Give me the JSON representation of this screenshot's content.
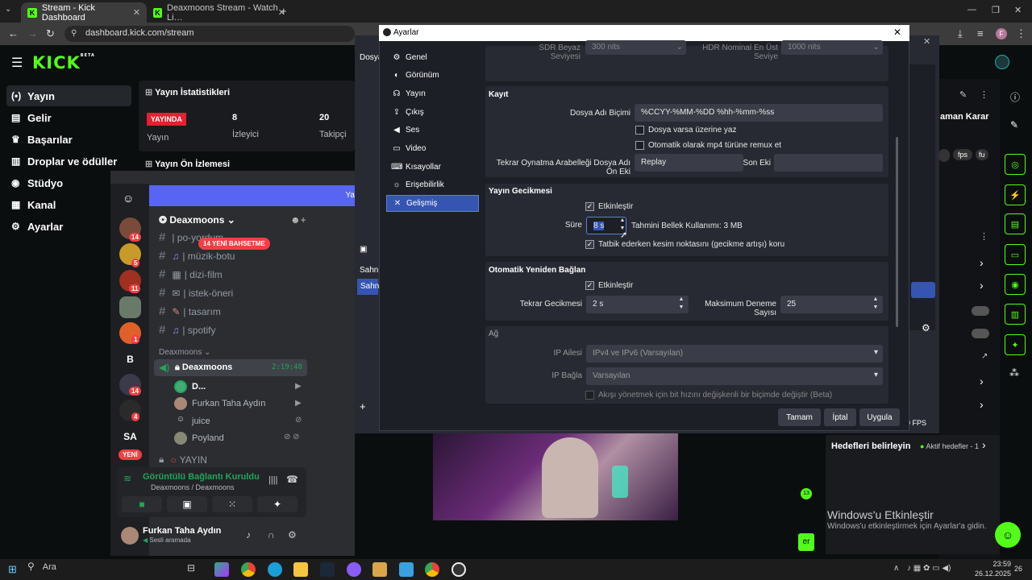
{
  "browser": {
    "tabs": [
      {
        "label": "Stream - Kick Dashboard",
        "active": true
      },
      {
        "label": "Deaxmoons Stream - Watch Li…",
        "active": false
      }
    ],
    "url": "dashboard.kick.com/stream",
    "profile_initial": "F"
  },
  "kick": {
    "logo": "KICK",
    "logo_beta": "BETA",
    "nav": [
      {
        "label": "Yayın",
        "icon": "broadcast-icon"
      },
      {
        "label": "Gelir",
        "icon": "money-icon"
      },
      {
        "label": "Başarılar",
        "icon": "trophy-icon"
      },
      {
        "label": "Droplar ve ödüller",
        "icon": "gift-icon"
      },
      {
        "label": "Stüdyo",
        "icon": "studio-icon"
      },
      {
        "label": "Kanal",
        "icon": "channel-icon"
      },
      {
        "label": "Ayarlar",
        "icon": "gear-icon"
      }
    ],
    "stats_title": "Yayın İstatistikleri",
    "live_badge": "YAYINDA",
    "live_label": "Yayın",
    "viewers_value": "8",
    "viewers_label": "İzleyici",
    "followers_value": "20",
    "followers_label": "Takipçi",
    "preview_title": "Yayın Ön İzlemesi",
    "right_labels": {
      "karar": "aman Karar",
      "fps_chip": "fps",
      "fu_chip": "fu",
      "hedef": "Hedefleri belirleyin",
      "aktif": "Aktif hedefler - 1",
      "fps": "FPS",
      "badge13": "13",
      "er": "er"
    },
    "accent": "#53fc18"
  },
  "discord": {
    "server_name": "Deaxmoons",
    "new_mentions": "14 YENİ BAHSETME",
    "channels": [
      {
        "name": "| po-yordum",
        "icon": "#"
      },
      {
        "name": "| müzik-botu",
        "icon": "♫"
      },
      {
        "name": "| dizi-film",
        "icon": "▦"
      },
      {
        "name": "| istek-öneri",
        "icon": "✉"
      },
      {
        "name": "| tasarım",
        "icon": "✎"
      },
      {
        "name": "| spotify",
        "icon": "♫"
      }
    ],
    "category": "Deaxmoons",
    "voice_channel": "Deaxmoons",
    "voice_timer": "2:19:48",
    "voice_users": [
      "D...",
      "Furkan Taha Aydın",
      "juice",
      "Poyland"
    ],
    "yayin_channel": "YAYIN",
    "server_badges": [
      "14",
      "5",
      "11",
      "1",
      "14",
      "4"
    ],
    "server_b": "B",
    "server_sa": "SA",
    "yeni_badge": "YENİ",
    "connection_title": "Görüntülü Bağlantı Kuruldu",
    "connection_sub": "Deaxmoons / Deaxmoons",
    "me_name": "Furkan Taha Aydın",
    "me_status": "Sesli aramada"
  },
  "obs_dialog": {
    "title": "Ayarlar",
    "nav": [
      {
        "label": "Genel",
        "icon": "⚙"
      },
      {
        "label": "Görünüm",
        "icon": "◐"
      },
      {
        "label": "Yayın",
        "icon": "☊"
      },
      {
        "label": "Çıkış",
        "icon": "⇪"
      },
      {
        "label": "Ses",
        "icon": "◀"
      },
      {
        "label": "Video",
        "icon": "▭"
      },
      {
        "label": "Kısayollar",
        "icon": "⌨"
      },
      {
        "label": "Erişebilirlik",
        "icon": "☼"
      },
      {
        "label": "Gelişmiş",
        "icon": "✕"
      }
    ],
    "top_partial": {
      "sdr_label": "SDR Beyaz Seviyesi",
      "sdr_value": "300 nits",
      "hdr_label": "HDR Nominal En Üst Seviye",
      "hdr_value": "1000 nits"
    },
    "kayit": {
      "title": "Kayıt",
      "dosya_label": "Dosya Adı Biçimi",
      "dosya_value": "%CCYY-%MM-%DD %hh-%mm-%ss",
      "chk1": "Dosya varsa üzerine yaz",
      "chk2": "Otomatik olarak mp4 türüne remux et",
      "replay_label": "Tekrar Oynatma Arabelleği Dosya Adı Ön Eki",
      "replay_value": "Replay",
      "son_eki": "Son Eki"
    },
    "gecikme": {
      "title": "Yayın Gecikmesi",
      "enable": "Etkinleştir",
      "sure_label": "Süre",
      "sure_value": "8 s",
      "mem": "Tahmini Bellek Kullanımı: 3 MB",
      "koru": "Tatbik ederken kesim noktasını (gecikme artışı) koru"
    },
    "reconnect": {
      "title": "Otomatik Yeniden Bağlan",
      "enable": "Etkinleştir",
      "delay_label": "Tekrar Gecikmesi",
      "delay_value": "2 s",
      "max_label": "Maksimum Deneme Sayısı",
      "max_value": "25"
    },
    "ag": {
      "title": "Ağ",
      "ip_family_label": "IP Ailesi",
      "ip_family_value": "IPv4 ve IPv6 (Varsayılan)",
      "ip_bind_label": "IP Bağla",
      "ip_bind_value": "Varsayılan",
      "dyn": "Akışı yönetmek için bit hızını değişkenli bir biçimde değiştir (Beta)"
    },
    "buttons": {
      "ok": "Tamam",
      "cancel": "İptal",
      "apply": "Uygula"
    },
    "bg_labels": {
      "dosya": "Dosya",
      "sahne": "Sahn"
    },
    "accent": "#3655b3"
  },
  "windows": {
    "activate_title": "Windows'u Etkinleştir",
    "activate_sub": "Windows'u etkinleştirmek için Ayarlar'a gidin.",
    "search": "Ara",
    "time": "23:59",
    "date": "26.12.2025",
    "notif": "26"
  }
}
